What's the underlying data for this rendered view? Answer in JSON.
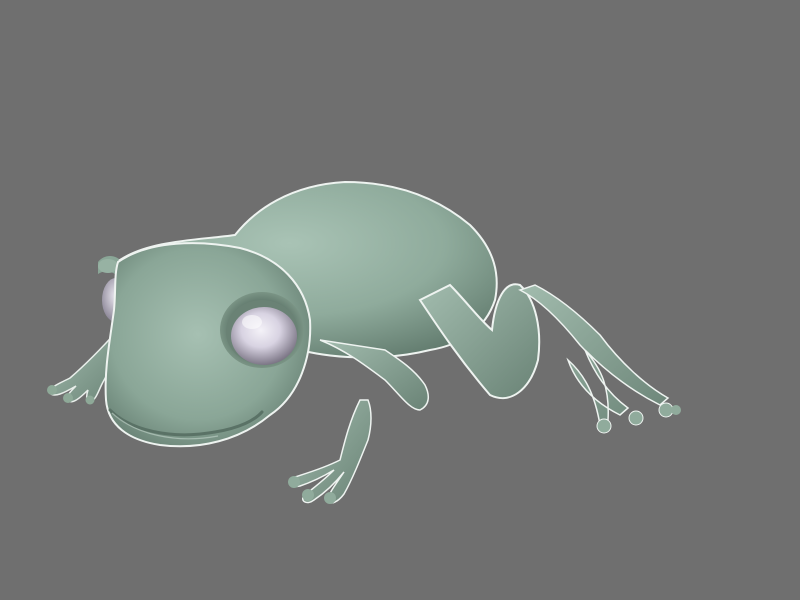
{
  "scene": {
    "background_color": "#6f6f6f",
    "subject": "frog-3d-model",
    "colors": {
      "skin_light": "#9fb9ab",
      "skin_mid": "#89a596",
      "skin_dark": "#5c7468",
      "rim_light": "#e8eeea",
      "eye_white": "#e4e0ec",
      "eye_shadow": "#7a7486",
      "eye_socket": "#6c8579"
    }
  }
}
